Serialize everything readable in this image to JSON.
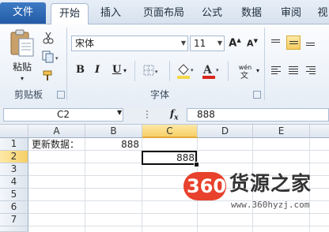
{
  "tabs": [
    {
      "label": "文件"
    },
    {
      "label": "开始"
    },
    {
      "label": "插入"
    },
    {
      "label": "页面布局"
    },
    {
      "label": "公式"
    },
    {
      "label": "数据"
    },
    {
      "label": "审阅"
    },
    {
      "label": "视"
    }
  ],
  "ribbon": {
    "clipboard": {
      "paste_label": "粘贴",
      "group_label": "剪贴板"
    },
    "font": {
      "font_name": "宋体",
      "font_size": "11",
      "group_label": "字体",
      "bold": "B",
      "italic": "I",
      "underline": "U",
      "wen": "wén"
    },
    "colors": {
      "accent": "#2b5fa8",
      "highlight": "#f5d74a",
      "font_color": "#d9261c"
    }
  },
  "formula_bar": {
    "name_box": "C2",
    "fx": "fx",
    "value": "888"
  },
  "grid": {
    "columns": [
      "A",
      "B",
      "C",
      "D",
      "E"
    ],
    "rows": [
      "1",
      "2",
      "3",
      "4",
      "5",
      "6",
      "7",
      "8"
    ],
    "cells": {
      "A1": "更新数据：",
      "B1": "888",
      "C2": "888"
    },
    "selected_cell": "C2"
  },
  "watermark": {
    "logo": "360",
    "text": "货源之家",
    "url": "www.360hyzj.com"
  }
}
